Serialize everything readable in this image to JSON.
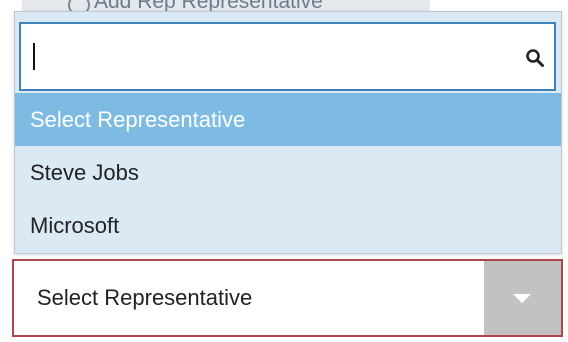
{
  "background": {
    "link_text": "Add Rep Representative"
  },
  "search": {
    "value": "",
    "placeholder": "",
    "icon": "search-icon"
  },
  "options": [
    {
      "label": "Select Representative",
      "selected": true
    },
    {
      "label": "Steve Jobs",
      "selected": false
    },
    {
      "label": "Microsoft",
      "selected": false
    }
  ],
  "select": {
    "value": "Select Representative",
    "icon": "chevron-down-icon"
  },
  "colors": {
    "search_border": "#3d82ba",
    "selected_option_bg": "#7dbbe2",
    "panel_bg": "#dbe9f5",
    "select_border": "#b0464d",
    "arrow_box_bg": "#c2c2c2"
  }
}
